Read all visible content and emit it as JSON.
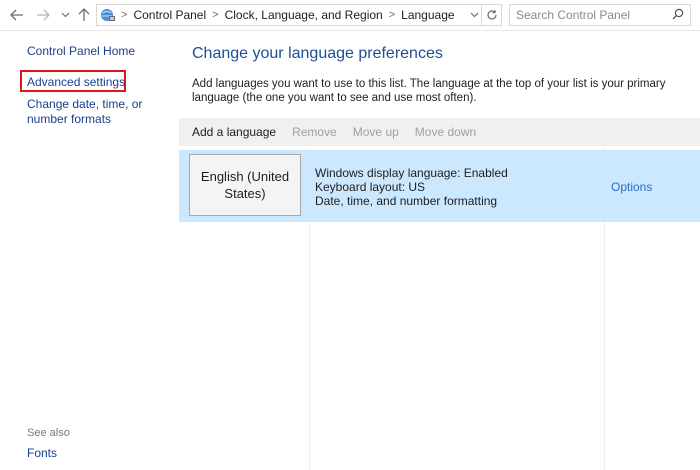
{
  "address_bar": {
    "breadcrumbs": [
      "Control Panel",
      "Clock, Language, and Region",
      "Language"
    ],
    "search_placeholder": "Search Control Panel"
  },
  "left_pane": {
    "home_link": "Control Panel Home",
    "links": [
      "Advanced settings",
      "Change date, time, or number formats"
    ],
    "see_also_label": "See also",
    "see_also_links": [
      "Fonts"
    ]
  },
  "main": {
    "heading": "Change your language preferences",
    "description": "Add languages you want to use to this list. The language at the top of your list is your primary language (the one you want to see and use most often).",
    "toolbar": {
      "add": "Add a language",
      "remove": "Remove",
      "move_up": "Move up",
      "move_down": "Move down"
    },
    "languages": [
      {
        "name": "English (United States)",
        "details": [
          "Windows display language: Enabled",
          "Keyboard layout: US",
          "Date, time, and number formatting"
        ],
        "options_label": "Options"
      }
    ]
  },
  "colors": {
    "selected_row": "#cce8ff",
    "heading": "#1e4f93",
    "link": "#1a3e8c",
    "highlight": "#e3141a"
  }
}
